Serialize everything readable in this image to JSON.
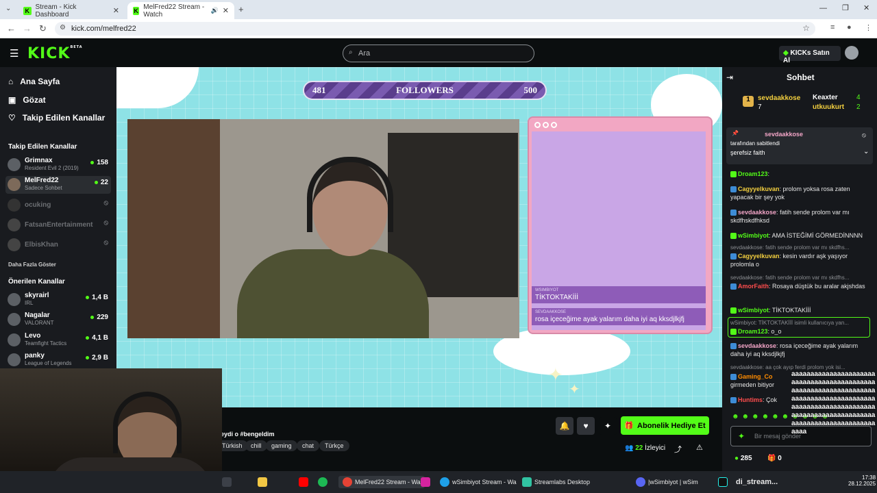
{
  "browser": {
    "tabs": [
      {
        "title": "Stream - Kick Dashboard"
      },
      {
        "title": "MelFred22 Stream - Watch"
      }
    ],
    "url": "kick.com/melfred22"
  },
  "header": {
    "logo": "KICK",
    "logo_badge": "BETA",
    "search_placeholder": "Ara",
    "kicks_button": "KICKs Satın Al"
  },
  "sidebar": {
    "nav": [
      {
        "label": "Ana Sayfa",
        "icon": "home-icon"
      },
      {
        "label": "Gözat",
        "icon": "browse-icon"
      },
      {
        "label": "Takip Edilen Kanallar",
        "icon": "heart-icon"
      }
    ],
    "followed_heading": "Takip Edilen Kanallar",
    "followed": [
      {
        "name": "Grimnax",
        "game": "Resident Evil 2 (2019)",
        "viewers": "158",
        "live": true
      },
      {
        "name": "MelFred22",
        "game": "Sadece Sohbet",
        "viewers": "22",
        "live": true
      },
      {
        "name": "ocuking",
        "game": "",
        "viewers": "",
        "live": false
      },
      {
        "name": "FatsanEntertainment",
        "game": "",
        "viewers": "",
        "live": false
      },
      {
        "name": "ElbisKhan",
        "game": "",
        "viewers": "",
        "live": false
      }
    ],
    "show_more": "Daha Fazla Göster",
    "recommended_heading": "Önerilen Kanallar",
    "recommended": [
      {
        "name": "skyrairl",
        "game": "IRL",
        "viewers": "1,4 B"
      },
      {
        "name": "Nagalar",
        "game": "VALORANT",
        "viewers": "229"
      },
      {
        "name": "Levo",
        "game": "Teamfight Tactics",
        "viewers": "4,1 B"
      },
      {
        "name": "panky",
        "game": "League of Legends",
        "viewers": "2,9 B"
      }
    ]
  },
  "stream_overlay": {
    "followers_current": "481",
    "followers_label": "FOLLOWERS",
    "followers_goal": "500",
    "followers_progress": 0.62,
    "overlay_messages": [
      {
        "user": "WSIMBIYOT",
        "text": "TİKTOKTAKİİİ"
      },
      {
        "user": "SEVDAAKKOSE",
        "text": "rosa içeceğime ayak yalarım daha iyi aq kksdjlkjfj"
      }
    ]
  },
  "below_player": {
    "title_fragment": "eydi o #bengeldim",
    "tags": [
      "Türkish",
      "chill",
      "gaming",
      "chat",
      "Türkçe"
    ],
    "gift_button": "Abonelik Hediye Et",
    "viewers": "22",
    "viewers_label": "İzleyici"
  },
  "chat": {
    "title": "Sohbet",
    "leaderboard": [
      {
        "rank": "1",
        "name": "sevdaakkose",
        "value": "7"
      },
      {
        "name": "Keaxter",
        "value": "4"
      },
      {
        "name": "utkuukurt",
        "value": "2"
      }
    ],
    "pinned": {
      "user": "sevdaakkose",
      "pinned_by": "tarafından sabitlendi",
      "text": "şerefsiz faith"
    },
    "messages": [
      {
        "user": "Droam123",
        "text": "",
        "color": "#53fc18"
      },
      {
        "user": "Cagyyelkuvan",
        "text": "prolom yoksa rosa zaten yapacak bir şey yok",
        "color": "#f4d03f"
      },
      {
        "user": "sevdaakkose",
        "text": "fatih sende prolom var mı skdfhskdfhksd",
        "color": "#f4d03f"
      },
      {
        "user": "wSimbiyot",
        "text": "AMA İSTEĞİMİ GÖRMEDİNNNN",
        "color": "#53fc18"
      },
      {
        "user": "Cagyyelkuvan",
        "text": "kesin vardır aşk yaşıyor prolomla o",
        "color": "#f4d03f",
        "reply": "sevdaakkose: fatih sende prolom var mı skdfhs..."
      },
      {
        "user": "AmorFaith",
        "text": "Rosaya düştük bu aralar akjshdas",
        "color": "#ff4d4d",
        "reply": "sevdaakkose: fatih sende prolom var mı skdfhs..."
      },
      {
        "user": "wSimbiyot",
        "text": "TİKTOKTAKİİİ",
        "color": "#53fc18"
      },
      {
        "user": "Droam123",
        "text": "o_o",
        "color": "#53fc18",
        "reply": "wSimbiyot: TİKTOKTAKİİİ isimli kullanıcıya yan..."
      },
      {
        "user": "sevdaakkose",
        "text": "rosa içeceğime ayak yalarım daha iyi aq kksdjlkjfj",
        "color": "#f4d03f"
      },
      {
        "user": "Gaming_Co",
        "text": "girmeden bitiyor",
        "color": "#ff8c00",
        "reply": "sevdaakkose: aa çok ayıp ferdi prolom yok isi..."
      },
      {
        "user": "Huntims",
        "text": "Çok",
        "color": "#ff4d4d"
      }
    ],
    "input_placeholder": "Bir mesaj gönder",
    "points": "285",
    "gifts": "0",
    "spam_overlay": "aaaaaaaaaaaaaaaaaaaaaaaaaaaaaaaaaaaaaaaaaaaaaaaaaaaaaaaaaaaaaaaaaaaaaaaaaaaaaaaaaaaaaaaaaaaaaaaaaaaaaaaaaaaaaaaaaaaaaaaaaaaaaaaaaaaaaaaaaaaaaaaaaaaaaaaaaaaaaa"
  },
  "taskbar": {
    "items": [
      "MelFred22 Stream - Wa",
      "wSimbiyot Stream - Wa",
      "Streamlabs Desktop",
      "|wSimbiyot | wSim",
      "di_stream..."
    ],
    "time": "17:38",
    "date": "28.12.2025"
  },
  "colors": {
    "brand": "#53fc18",
    "background": "#0b0e0f",
    "player_bg": "#8ee2e6"
  }
}
